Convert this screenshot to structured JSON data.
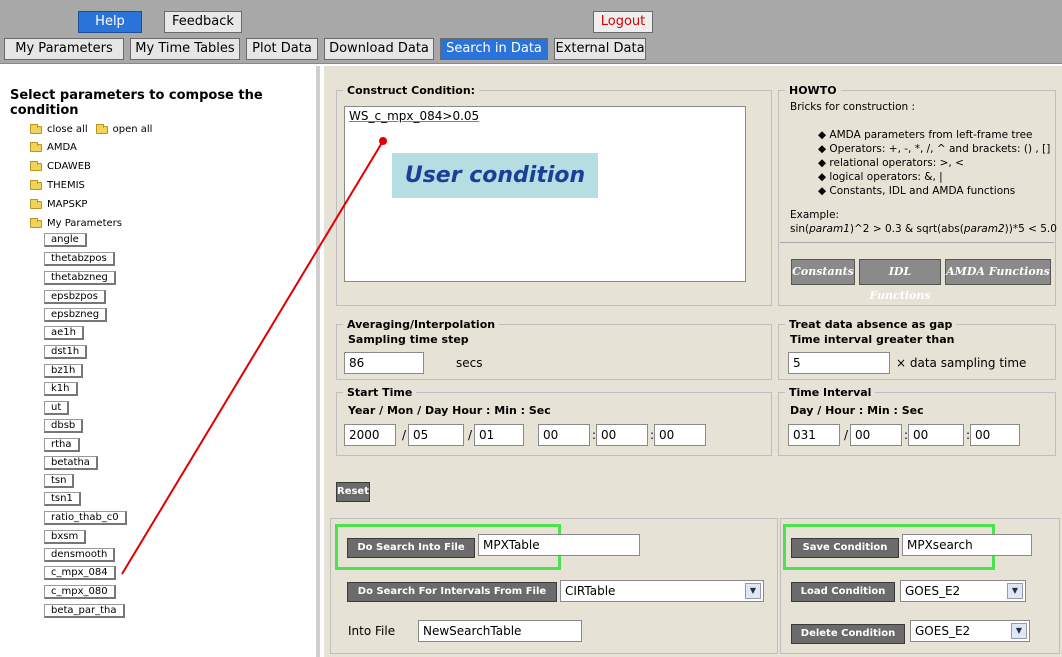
{
  "top_buttons": {
    "help": "Help",
    "feedback": "Feedback",
    "logout": "Logout"
  },
  "tabs": [
    "My Parameters",
    "My Time Tables",
    "Plot Data",
    "Download Data",
    "Search in Data",
    "External Data"
  ],
  "left": {
    "title": "Select parameters to compose the condition",
    "close_all": "close all",
    "open_all": "open all",
    "folders": [
      "AMDA",
      "CDAWEB",
      "THEMIS",
      "MAPSKP",
      "My Parameters"
    ],
    "params": [
      "angle",
      "thetabzpos",
      "thetabzneg",
      "epsbzpos",
      "epsbzneg",
      "ae1h",
      "dst1h",
      "bz1h",
      "k1h",
      "ut",
      "dbsb",
      "rtha",
      "betatha",
      "tsn",
      "tsn1",
      "ratio_thab_c0",
      "bxsm",
      "densmooth",
      "c_mpx_084",
      "c_mpx_080",
      "beta_par_tha"
    ]
  },
  "construct": {
    "legend": "Construct Condition:",
    "value": "WS_c_mpx_084>0.05",
    "annotation": "User condition"
  },
  "howto": {
    "legend": "HOWTO",
    "intro": "Bricks for construction :",
    "bullets": [
      "AMDA parameters from left-frame tree",
      "Operators: +, -, *, /, ^ and brackets: () , []",
      "relational operators: >, <",
      "logical operators: &, |",
      "Constants, IDL and AMDA functions"
    ],
    "example_label": "Example:",
    "example_parts": [
      "sin(",
      "param1",
      ")^2 > 0.3 & sqrt(abs(",
      "param2",
      "))*5 < 5.0"
    ],
    "buttons": [
      "Constants",
      "IDL Functions",
      "AMDA Functions"
    ]
  },
  "averaging": {
    "legend": "Averaging/Interpolation",
    "label": "Sampling time step",
    "value": "86",
    "unit": "secs"
  },
  "gap": {
    "legend": "Treat data absence as gap",
    "label": "Time interval greater than",
    "value": "5",
    "unit": "× data sampling time"
  },
  "start_time": {
    "legend": "Start Time",
    "label": "Year / Mon / Day  Hour : Min : Sec",
    "year": "2000",
    "mon": "05",
    "day": "01",
    "hour": "00",
    "min": "00",
    "sec": "00"
  },
  "time_interval": {
    "legend": "Time Interval",
    "label": "Day / Hour : Min : Sec",
    "day": "031",
    "hour": "00",
    "min": "00",
    "sec": "00"
  },
  "reset": "Reset",
  "search_file": {
    "button": "Do Search Into File",
    "value": "MPXTable"
  },
  "save_condition": {
    "button": "Save Condition",
    "value": "MPXsearch"
  },
  "search_intervals": {
    "button": "Do Search For Intervals From File",
    "selected": "CIRTable"
  },
  "load_condition": {
    "button": "Load Condition",
    "selected": "GOES_E2"
  },
  "into_file": {
    "label": "Into File",
    "value": "NewSearchTable"
  },
  "delete_condition": {
    "button": "Delete Condition",
    "selected": "GOES_E2"
  },
  "colors": {
    "accent_blue": "#2a74d9",
    "highlight_green": "#4be34b",
    "annotation_bg": "#b6dde2",
    "annotation_text": "#1a3f99",
    "arrow_red": "#e00000"
  }
}
